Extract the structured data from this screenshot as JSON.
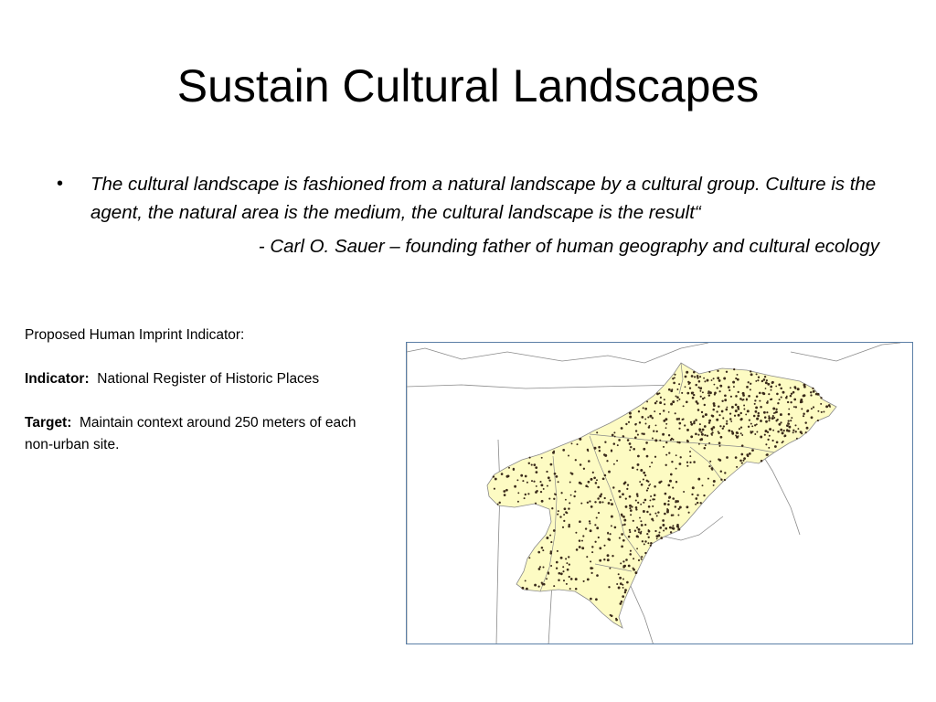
{
  "slide": {
    "title": "Sustain Cultural Landscapes",
    "quote": {
      "bullet": "•",
      "text": "The cultural landscape is fashioned from a natural landscape by a cultural group. Culture is the agent, the natural area is the medium, the cultural landscape is the result“",
      "attribution": "- Carl O. Sauer – founding father of human geography and cultural ecology"
    },
    "indicator_panel": {
      "heading": "Proposed Human Imprint Indicator:",
      "indicator_label": "Indicator:",
      "indicator_value": "National Register of Historic Places",
      "target_label": "Target:",
      "target_value": "Maintain context around 250 meters of each non-urban site."
    },
    "map": {
      "region_fill": "#fdfbc3",
      "outline_color": "#8a8a8a",
      "site_dot_color": "#3a2a1a",
      "frame_color": "#5b7fa6"
    }
  }
}
